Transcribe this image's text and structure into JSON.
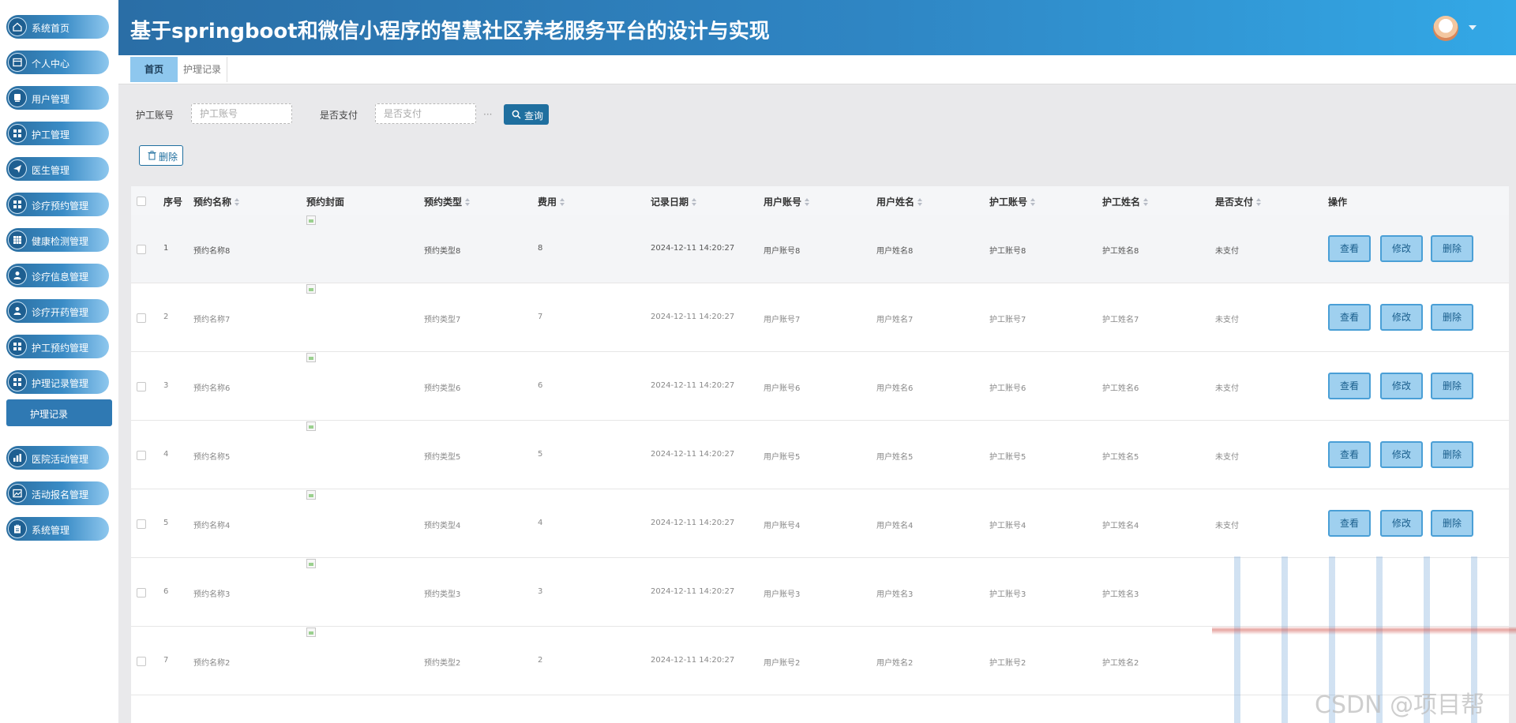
{
  "app": {
    "title": "基于springboot和微信小程序的智慧社区养老服务平台的设计与实现"
  },
  "sidebar": {
    "items": [
      {
        "label": "系统首页",
        "icon": "home-icon"
      },
      {
        "label": "个人中心",
        "icon": "window-icon"
      },
      {
        "label": "用户管理",
        "icon": "user-card-icon"
      },
      {
        "label": "护工管理",
        "icon": "grid-icon"
      },
      {
        "label": "医生管理",
        "icon": "send-icon"
      },
      {
        "label": "诊疗预约管理",
        "icon": "grid-icon"
      },
      {
        "label": "健康检测管理",
        "icon": "grid-icon"
      },
      {
        "label": "诊疗信息管理",
        "icon": "person-icon"
      },
      {
        "label": "诊疗开药管理",
        "icon": "person-icon"
      },
      {
        "label": "护工预约管理",
        "icon": "grid-icon"
      },
      {
        "label": "护理记录管理",
        "icon": "grid-icon"
      },
      {
        "label": "医院活动管理",
        "icon": "chart-icon"
      },
      {
        "label": "活动报名管理",
        "icon": "image-icon"
      },
      {
        "label": "系统管理",
        "icon": "clipboard-icon"
      }
    ],
    "active_sub": "护理记录"
  },
  "tabs": [
    "首页",
    "护理记录"
  ],
  "search": {
    "field1_label": "护工账号",
    "field1_placeholder": "护工账号",
    "field2_label": "是否支付",
    "field2_placeholder": "是否支付",
    "ellipsis": "···",
    "query_label": "查询"
  },
  "toolbar": {
    "delete_label": "删除"
  },
  "table": {
    "columns": [
      "序号",
      "预约名称",
      "预约封面",
      "预约类型",
      "费用",
      "记录日期",
      "用户账号",
      "用户姓名",
      "护工账号",
      "护工姓名",
      "是否支付",
      "操作"
    ],
    "rows": [
      {
        "index": "1",
        "name": "预约名称8",
        "type": "预约类型8",
        "fee": "8",
        "date": "2024-12-11 14:20:27",
        "user_account": "用户账号8",
        "user_name": "用户姓名8",
        "nurse_account": "护工账号8",
        "nurse_name": "护工姓名8",
        "paid": "未支付"
      },
      {
        "index": "2",
        "name": "预约名称7",
        "type": "预约类型7",
        "fee": "7",
        "date": "2024-12-11 14:20:27",
        "user_account": "用户账号7",
        "user_name": "用户姓名7",
        "nurse_account": "护工账号7",
        "nurse_name": "护工姓名7",
        "paid": "未支付"
      },
      {
        "index": "3",
        "name": "预约名称6",
        "type": "预约类型6",
        "fee": "6",
        "date": "2024-12-11 14:20:27",
        "user_account": "用户账号6",
        "user_name": "用户姓名6",
        "nurse_account": "护工账号6",
        "nurse_name": "护工姓名6",
        "paid": "未支付"
      },
      {
        "index": "4",
        "name": "预约名称5",
        "type": "预约类型5",
        "fee": "5",
        "date": "2024-12-11 14:20:27",
        "user_account": "用户账号5",
        "user_name": "用户姓名5",
        "nurse_account": "护工账号5",
        "nurse_name": "护工姓名5",
        "paid": "未支付"
      },
      {
        "index": "5",
        "name": "预约名称4",
        "type": "预约类型4",
        "fee": "4",
        "date": "2024-12-11 14:20:27",
        "user_account": "用户账号4",
        "user_name": "用户姓名4",
        "nurse_account": "护工账号4",
        "nurse_name": "护工姓名4",
        "paid": "未支付"
      },
      {
        "index": "6",
        "name": "预约名称3",
        "type": "预约类型3",
        "fee": "3",
        "date": "2024-12-11 14:20:27",
        "user_account": "用户账号3",
        "user_name": "用户姓名3",
        "nurse_account": "护工账号3",
        "nurse_name": "护工姓名3",
        "paid": ""
      },
      {
        "index": "7",
        "name": "预约名称2",
        "type": "预约类型2",
        "fee": "2",
        "date": "2024-12-11 14:20:27",
        "user_account": "用户账号2",
        "user_name": "用户姓名2",
        "nurse_account": "护工账号2",
        "nurse_name": "护工姓名2",
        "paid": ""
      }
    ],
    "actions": [
      "查看",
      "修改",
      "删除"
    ]
  },
  "watermark": "CSDN @项目帮",
  "colors": {
    "header_start": "#2a6ea6",
    "header_end": "#33a8e6",
    "accent": "#1f6f9f",
    "action_button": "#9fd0ef"
  }
}
